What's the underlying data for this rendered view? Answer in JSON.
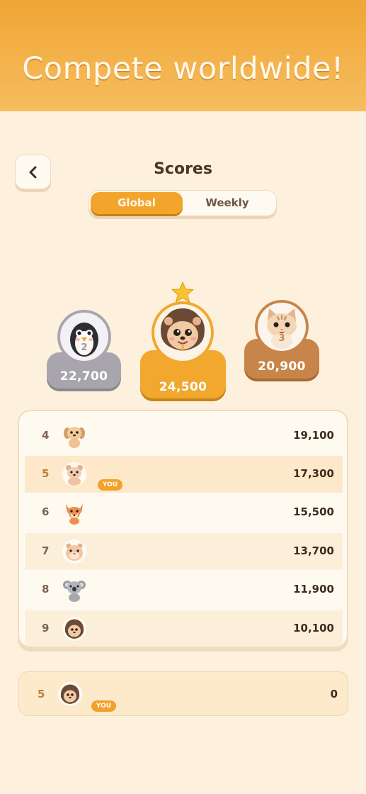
{
  "banner": {
    "title": "Compete worldwide!"
  },
  "header": {
    "title": "Scores",
    "back_icon": "chevron-left-icon"
  },
  "tabs": [
    {
      "label": "Global",
      "selected": true
    },
    {
      "label": "Weekly",
      "selected": false
    }
  ],
  "podium": {
    "first": {
      "rank": "1",
      "score": "24,500",
      "avatar": "hedgehog",
      "badge_icon": "star-icon"
    },
    "second": {
      "rank": "2",
      "score": "22,700",
      "avatar": "penguin"
    },
    "third": {
      "rank": "3",
      "score": "20,900",
      "avatar": "cat"
    }
  },
  "leaderboard": [
    {
      "rank": "4",
      "avatar": "puppy",
      "score": "19,100"
    },
    {
      "rank": "5",
      "avatar": "bear",
      "score": "17,300",
      "badge": "YOU"
    },
    {
      "rank": "6",
      "avatar": "fox",
      "score": "15,500"
    },
    {
      "rank": "7",
      "avatar": "hamster",
      "score": "13,700"
    },
    {
      "rank": "8",
      "avatar": "koala",
      "score": "11,900"
    },
    {
      "rank": "9",
      "avatar": "hedgehog",
      "score": "10,100"
    }
  ],
  "current_user": {
    "rank": "5",
    "avatar": "hedgehog",
    "badge": "YOU",
    "score": "0"
  },
  "colors": {
    "accent": "#f3a52b",
    "background": "#fdf0dd",
    "silver": "#a8a6ac",
    "bronze": "#c8854a"
  }
}
